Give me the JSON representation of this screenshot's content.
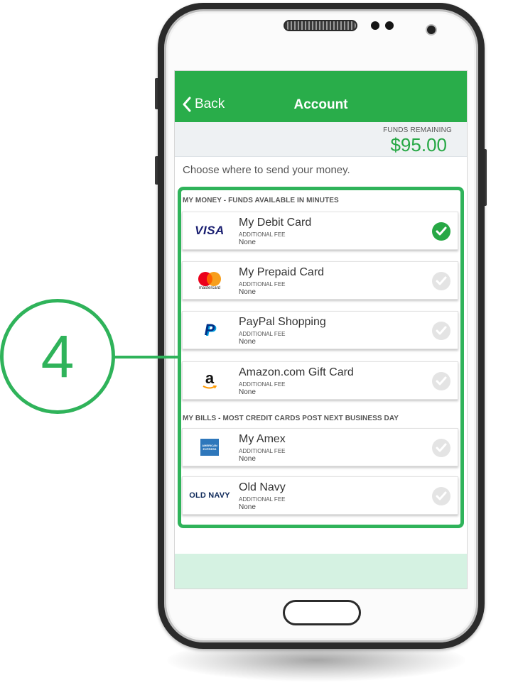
{
  "header": {
    "back_label": "Back",
    "title": "Account"
  },
  "funds": {
    "label": "FUNDS REMAINING",
    "amount": "$95.00"
  },
  "prompt": "Choose where to send your money.",
  "callout": {
    "number": "4"
  },
  "sections": [
    {
      "title": "MY MONEY - FUNDS AVAILABLE IN MINUTES",
      "cards": [
        {
          "name": "My Debit Card",
          "fee_label": "ADDITIONAL FEE",
          "fee_value": "None",
          "logo": "visa-logo",
          "logo_text": "VISA",
          "selected": true
        },
        {
          "name": "My Prepaid Card",
          "fee_label": "ADDITIONAL FEE",
          "fee_value": "None",
          "logo": "mastercard-logo",
          "logo_text": "mastercard",
          "selected": false
        },
        {
          "name": "PayPal Shopping",
          "fee_label": "ADDITIONAL FEE",
          "fee_value": "None",
          "logo": "paypal-logo",
          "logo_text": "P",
          "selected": false
        },
        {
          "name": "Amazon.com Gift Card",
          "fee_label": "ADDITIONAL FEE",
          "fee_value": "None",
          "logo": "amazon-logo",
          "logo_text": "a",
          "selected": false
        }
      ]
    },
    {
      "title": "MY BILLS - MOST CREDIT CARDS POST NEXT BUSINESS DAY",
      "cards": [
        {
          "name": "My Amex",
          "fee_label": "ADDITIONAL FEE",
          "fee_value": "None",
          "logo": "amex-logo",
          "logo_text": "AMERICAN EXPRESS",
          "selected": false
        },
        {
          "name": "Old Navy",
          "fee_label": "ADDITIONAL FEE",
          "fee_value": "None",
          "logo": "old-navy-logo",
          "logo_text": "OLD NAVY",
          "selected": false
        }
      ]
    }
  ],
  "colors": {
    "brand_green": "#29ad4a",
    "amount_green": "#27a845",
    "callout_green": "#2fb35a",
    "footer_band": "#d5f2e2"
  }
}
